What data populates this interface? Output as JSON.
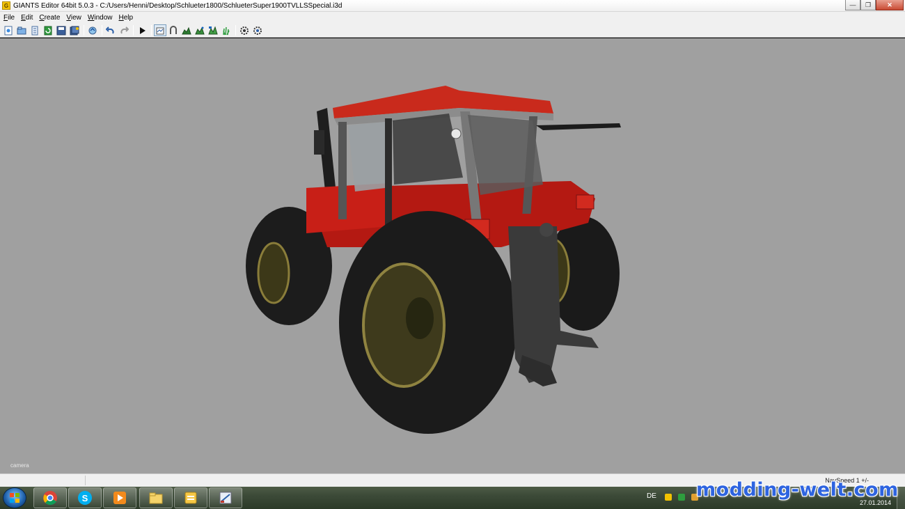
{
  "window": {
    "title": "GIANTS Editor 64bit 5.0.3 - C:/Users/Henni/Desktop/Schlueter1800/SchlueterSuper1900TVLLSSpecial.i3d",
    "app_icon": "giants-editor-icon",
    "controls": [
      "minimize-icon",
      "maximize-icon",
      "close-icon"
    ]
  },
  "menu": {
    "items": [
      {
        "label": "File"
      },
      {
        "label": "Edit"
      },
      {
        "label": "Create"
      },
      {
        "label": "View"
      },
      {
        "label": "Window"
      },
      {
        "label": "Help"
      }
    ]
  },
  "toolbar": {
    "icons": [
      "new-icon",
      "open-icon",
      "import-icon",
      "reload-icon",
      "save-icon",
      "save-all-icon",
      "export-icon",
      "undo-icon",
      "redo-icon",
      "play-icon",
      "select-icon",
      "move-icon",
      "terrain-sculpt-icon",
      "terrain-paint-icon",
      "foliage-paint-icon",
      "grass-icon",
      "settings-icon",
      "physics-icon"
    ],
    "active_tool": "select-icon"
  },
  "viewport": {
    "camera_label": "camera",
    "background_color": "#a0a0a0",
    "scene_object": "tractor-model"
  },
  "status": {
    "nav_speed": "NavSpeed 1 +/-"
  },
  "taskbar": {
    "start": "windows-start-icon",
    "apps": [
      "chrome-icon",
      "skype-icon",
      "media-player-icon",
      "explorer-icon",
      "notes-icon",
      "giants-editor-icon"
    ],
    "language": "DE",
    "date": "27.01.2014"
  },
  "watermark": {
    "text": "modding-welt.com"
  }
}
